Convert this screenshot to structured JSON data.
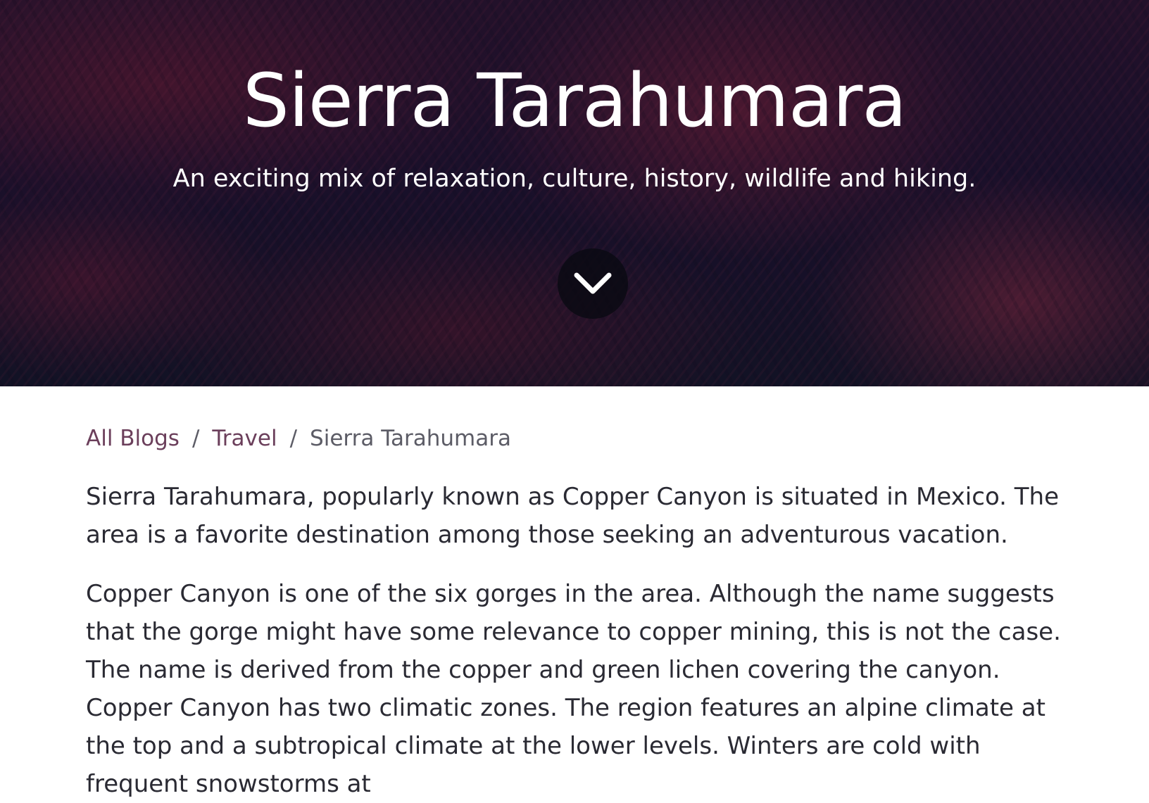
{
  "hero": {
    "title": "Sierra Tarahumara",
    "subtitle": "An exciting mix of relaxation, culture, history, wildlife and hiking.",
    "scroll_icon": "chevron-down-icon"
  },
  "breadcrumb": {
    "items": [
      {
        "label": "All Blogs"
      },
      {
        "label": "Travel"
      },
      {
        "label": "Sierra Tarahumara"
      }
    ],
    "separator": "/"
  },
  "article": {
    "paragraphs": [
      "Sierra Tarahumara, popularly known as Copper Canyon is situated in Mexico. The area is a favorite destination among those seeking an adventurous vacation.",
      "Copper Canyon is one of the six gorges in the area. Although the name suggests that the gorge might have some relevance to copper mining, this is not the case. The name is derived from the copper and green lichen covering the canyon. Copper Canyon has two climatic zones. The region features an alpine climate at the top and a subtropical climate at the lower levels. Winters are cold with frequent snowstorms at"
    ]
  },
  "colors": {
    "link": "#6b3f5b",
    "text": "#2a2a33",
    "muted": "#5c5c66",
    "hero_overlay": "#1e1230"
  }
}
